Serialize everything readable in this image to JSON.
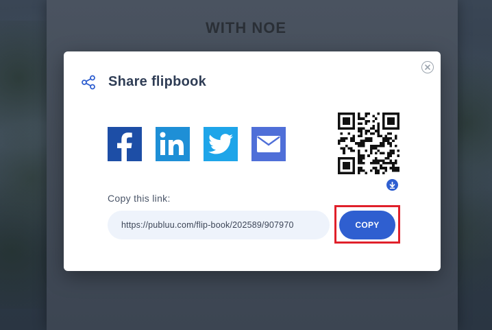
{
  "background": {
    "title": "WITH NOE"
  },
  "modal": {
    "title": "Share flipbook",
    "icons": {
      "share": "share-icon",
      "close": "close-icon",
      "download": "download-icon"
    },
    "social": [
      {
        "name": "facebook",
        "color": "#1d4ea6"
      },
      {
        "name": "linkedin",
        "color": "#1e8fd6"
      },
      {
        "name": "twitter",
        "color": "#1ea5e9"
      },
      {
        "name": "email",
        "color": "#4f6fd8"
      }
    ],
    "copy_label": "Copy this link:",
    "link_value": "https://publuu.com/flip-book/202589/907970",
    "copy_button": "COPY",
    "accent_color": "#2f5fd0",
    "highlight_color": "#e0202a"
  }
}
